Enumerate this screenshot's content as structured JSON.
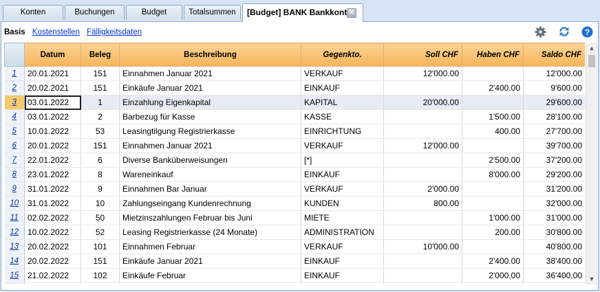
{
  "tabs": [
    "Konten",
    "Buchungen",
    "Budget",
    "Totalsummen",
    "[Budget] BANK Bankkonto"
  ],
  "subnav": {
    "active": "Basis",
    "links": [
      "Kostenstellen",
      "Fälligkeitsdaten"
    ]
  },
  "toolbar_icons": [
    "gear-icon",
    "refresh-icon",
    "help-icon"
  ],
  "columns": [
    "Datum",
    "Beleg",
    "Beschreibung",
    "Gegenkto.",
    "Soll CHF",
    "Haben CHF",
    "Saldo CHF"
  ],
  "rows": [
    {
      "n": "1",
      "datum": "20.01.2021",
      "beleg": "151",
      "beschreibung": "Einnahmen Januar 2021",
      "gegenkto": "VERKAUF",
      "soll": "12'000.00",
      "haben": "",
      "saldo": "12'000.00"
    },
    {
      "n": "2",
      "datum": "20.02.2021",
      "beleg": "151",
      "beschreibung": "Einkäufe Januar 2021",
      "gegenkto": "EINKAUF",
      "soll": "",
      "haben": "2'400.00",
      "saldo": "9'600.00"
    },
    {
      "n": "3",
      "datum": "03.01.2022",
      "beleg": "1",
      "beschreibung": "Einzahlung Eigenkapital",
      "gegenkto": "KAPITAL",
      "soll": "20'000.00",
      "haben": "",
      "saldo": "29'600.00"
    },
    {
      "n": "4",
      "datum": "03.01.2022",
      "beleg": "2",
      "beschreibung": "Barbezug für Kasse",
      "gegenkto": "KASSE",
      "soll": "",
      "haben": "1'500.00",
      "saldo": "28'100.00"
    },
    {
      "n": "5",
      "datum": "10.01.2022",
      "beleg": "53",
      "beschreibung": "Leasingtilgung Registrierkasse",
      "gegenkto": "EINRICHTUNG",
      "soll": "",
      "haben": "400.00",
      "saldo": "27'700.00"
    },
    {
      "n": "6",
      "datum": "20.01.2022",
      "beleg": "151",
      "beschreibung": "Einnahmen Januar 2021",
      "gegenkto": "VERKAUF",
      "soll": "12'000.00",
      "haben": "",
      "saldo": "39'700.00"
    },
    {
      "n": "7",
      "datum": "22.01.2022",
      "beleg": "6",
      "beschreibung": "Diverse Banküberweisungen",
      "gegenkto": "[*]",
      "soll": "",
      "haben": "2'500.00",
      "saldo": "37'200.00"
    },
    {
      "n": "8",
      "datum": "23.01.2022",
      "beleg": "8",
      "beschreibung": "Wareneinkauf",
      "gegenkto": "EINKAUF",
      "soll": "",
      "haben": "8'000.00",
      "saldo": "29'200.00"
    },
    {
      "n": "9",
      "datum": "31.01.2022",
      "beleg": "9",
      "beschreibung": "Einnahmen Bar Januar",
      "gegenkto": "VERKAUF",
      "soll": "2'000.00",
      "haben": "",
      "saldo": "31'200.00"
    },
    {
      "n": "10",
      "datum": "31.01.2022",
      "beleg": "10",
      "beschreibung": "Zahlungseingang Kundenrechnung",
      "gegenkto": "KUNDEN",
      "soll": "800.00",
      "haben": "",
      "saldo": "32'000.00"
    },
    {
      "n": "11",
      "datum": "02.02.2022",
      "beleg": "50",
      "beschreibung": "Mietzinszahlungen Februar bis Juni",
      "gegenkto": "MIETE",
      "soll": "",
      "haben": "1'000.00",
      "saldo": "31'000.00"
    },
    {
      "n": "12",
      "datum": "10.02.2022",
      "beleg": "52",
      "beschreibung": "Leasing Registrierkasse (24 Monate)",
      "gegenkto": "ADMINISTRATION",
      "soll": "",
      "haben": "200.00",
      "saldo": "30'800.00"
    },
    {
      "n": "13",
      "datum": "20.02.2022",
      "beleg": "101",
      "beschreibung": "Einnahmen Februar",
      "gegenkto": "VERKAUF",
      "soll": "10'000.00",
      "haben": "",
      "saldo": "40'800.00"
    },
    {
      "n": "14",
      "datum": "20.02.2022",
      "beleg": "151",
      "beschreibung": "Einkäufe Januar 2021",
      "gegenkto": "EINKAUF",
      "soll": "",
      "haben": "2'400.00",
      "saldo": "38'400.00"
    },
    {
      "n": "15",
      "datum": "21.02.2022",
      "beleg": "102",
      "beschreibung": "Einkäufe Februar",
      "gegenkto": "EINKAUF",
      "soll": "",
      "haben": "2'000.00",
      "saldo": "36'400.00"
    },
    {
      "n": "16",
      "datum": "",
      "beleg": "",
      "beschreibung": "",
      "gegenkto": "",
      "soll": "",
      "haben": "",
      "saldo": ""
    }
  ],
  "selected_row": 3,
  "colors": {
    "header_orange": "#f7b45a",
    "selected_row": "#e7ebf4",
    "link_blue": "#0033cc",
    "help_blue": "#1f6fd0"
  }
}
